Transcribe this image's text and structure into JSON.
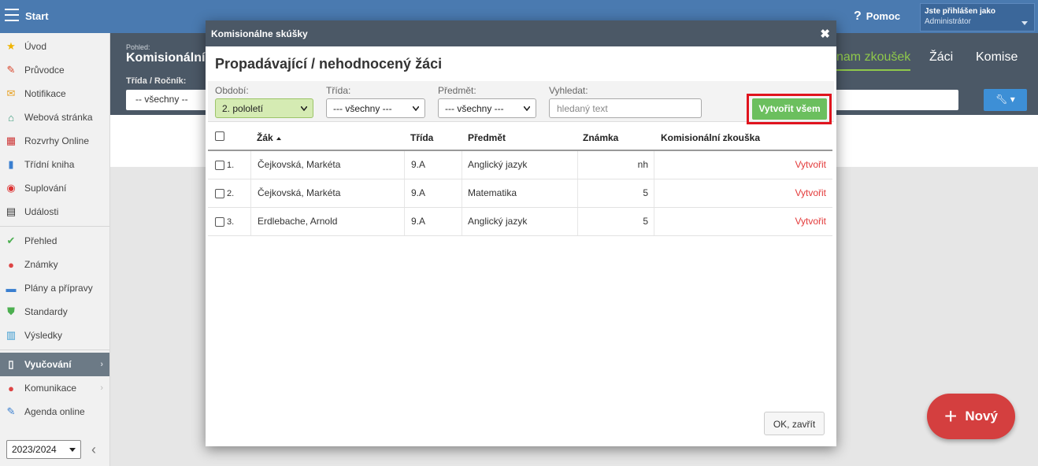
{
  "topbar": {
    "start_label": "Start",
    "help_label": "Pomoc",
    "user_label": "Jste přihlášen jako",
    "user_value": "Administrátor"
  },
  "sidebar": {
    "items": [
      {
        "label": "Úvod",
        "icon": "star-icon"
      },
      {
        "label": "Průvodce",
        "icon": "wand-icon"
      },
      {
        "label": "Notifikace",
        "icon": "envelope-icon"
      },
      {
        "label": "Webová stránka",
        "icon": "home-icon"
      },
      {
        "label": "Rozvrhy Online",
        "icon": "calendar-grid-icon"
      },
      {
        "label": "Třídní kniha",
        "icon": "book-icon"
      },
      {
        "label": "Suplování",
        "icon": "lifebuoy-icon"
      },
      {
        "label": "Události",
        "icon": "calendar-icon"
      },
      {
        "label": "Přehled",
        "icon": "check-circle-icon"
      },
      {
        "label": "Známky",
        "icon": "grade-icon"
      },
      {
        "label": "Plány a přípravy",
        "icon": "briefcase-icon"
      },
      {
        "label": "Standardy",
        "icon": "shield-icon"
      },
      {
        "label": "Výsledky",
        "icon": "bar-chart-icon"
      },
      {
        "label": "Vyučování",
        "icon": "open-book-icon"
      },
      {
        "label": "Komunikace",
        "icon": "chat-icon"
      },
      {
        "label": "Agenda online",
        "icon": "pen-icon"
      }
    ],
    "year_value": "2023/2024"
  },
  "page": {
    "view_label": "Pohled:",
    "view_title": "Komisionální",
    "filter_label": "Třída / Ročník:",
    "filter_value": "-- všechny --",
    "tabs": [
      "nam zkoušek",
      "Žáci",
      "Komise"
    ]
  },
  "fab": {
    "label": "Nový"
  },
  "modal": {
    "title": "Komisionálne skúšky",
    "heading": "Propadávající / nehodnocený žáci",
    "filters": {
      "obdobi_label": "Období:",
      "obdobi_value": "2. pololetí",
      "trida_label": "Třída:",
      "trida_value": "--- všechny ---",
      "predmet_label": "Předmět:",
      "predmet_value": "--- všechny ---",
      "search_label": "Vyhledat:",
      "search_placeholder": "hledaný text"
    },
    "create_all_label": "Vytvořit všem",
    "columns": [
      "Žák",
      "Třída",
      "Předmět",
      "Známka",
      "Komisionální zkouška"
    ],
    "rows": [
      {
        "num": "1.",
        "student": "Čejkovská, Markéta",
        "class": "9.A",
        "subject": "Anglický jazyk",
        "grade": "nh",
        "action": "Vytvořit"
      },
      {
        "num": "2.",
        "student": "Čejkovská, Markéta",
        "class": "9.A",
        "subject": "Matematika",
        "grade": "5",
        "action": "Vytvořit"
      },
      {
        "num": "3.",
        "student": "Erdlebache, Arnold",
        "class": "9.A",
        "subject": "Anglický jazyk",
        "grade": "5",
        "action": "Vytvořit"
      }
    ],
    "ok_label": "OK, zavřít"
  },
  "colors": {
    "topbar": "#4a7ab0",
    "header_dark": "#4b5866",
    "accent_green": "#6bbf5e",
    "tab_active": "#8fc84b",
    "link_red": "#e33a3a",
    "highlight_red": "#e0141e",
    "fab_red": "#d43f3f"
  }
}
